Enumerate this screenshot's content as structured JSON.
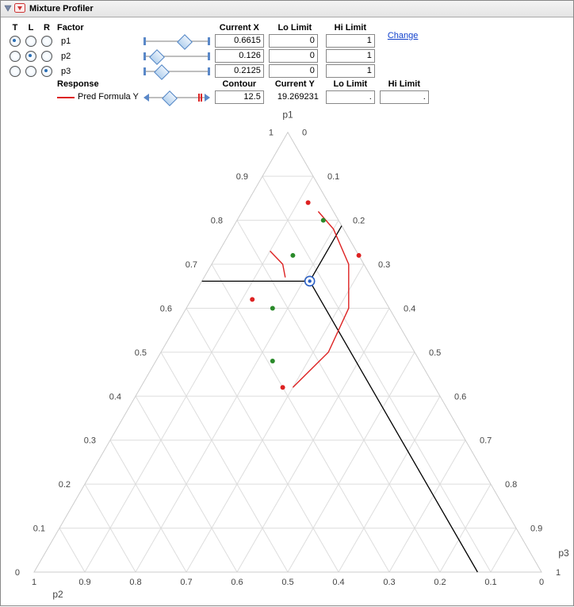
{
  "title": "Mixture Profiler",
  "link_change": "Change",
  "headers": {
    "t": "T",
    "l": "L",
    "r": "R",
    "factor": "Factor",
    "curX": "Current X",
    "lo": "Lo Limit",
    "hi": "Hi Limit",
    "response": "Response",
    "contour": "Contour",
    "curY": "Current Y"
  },
  "factors": [
    {
      "name": "p1",
      "sel": "t",
      "val": "0.6615",
      "lo": "0",
      "hi": "1",
      "thumb": 0.66
    },
    {
      "name": "p2",
      "sel": "l",
      "val": "0.126",
      "lo": "0",
      "hi": "1",
      "thumb": 0.126
    },
    {
      "name": "p3",
      "sel": "r",
      "val": "0.2125",
      "lo": "0",
      "hi": "1",
      "thumb": 0.2125
    }
  ],
  "response": {
    "name": "Pred Formula Y",
    "contour": "12.5",
    "curY": "19.269231",
    "lo": ".",
    "hi": ".",
    "thumb": 0.32
  },
  "axis": {
    "p1": "p1",
    "p2": "p2",
    "p3": "p3"
  },
  "chart_data": {
    "type": "ternary",
    "axes": {
      "top": "p1",
      "left": "p2",
      "right": "p3"
    },
    "current": {
      "p1": 0.6615,
      "p2": 0.126,
      "p3": 0.2125
    },
    "contour_value": 12.5,
    "green_points": [
      {
        "p1": 0.8,
        "p2": 0.03,
        "p3": 0.17
      },
      {
        "p1": 0.72,
        "p2": 0.13,
        "p3": 0.15
      },
      {
        "p1": 0.6,
        "p2": 0.23,
        "p3": 0.17
      },
      {
        "p1": 0.48,
        "p2": 0.29,
        "p3": 0.23
      }
    ],
    "red_points": [
      {
        "p1": 0.84,
        "p2": 0.04,
        "p3": 0.12
      },
      {
        "p1": 0.72,
        "p2": 0.0,
        "p3": 0.28
      },
      {
        "p1": 0.62,
        "p2": 0.26,
        "p3": 0.12
      },
      {
        "p1": 0.42,
        "p2": 0.3,
        "p3": 0.28
      }
    ],
    "ticks": [
      0,
      0.1,
      0.2,
      0.3,
      0.4,
      0.5,
      0.6,
      0.7,
      0.8,
      0.9,
      1
    ]
  }
}
